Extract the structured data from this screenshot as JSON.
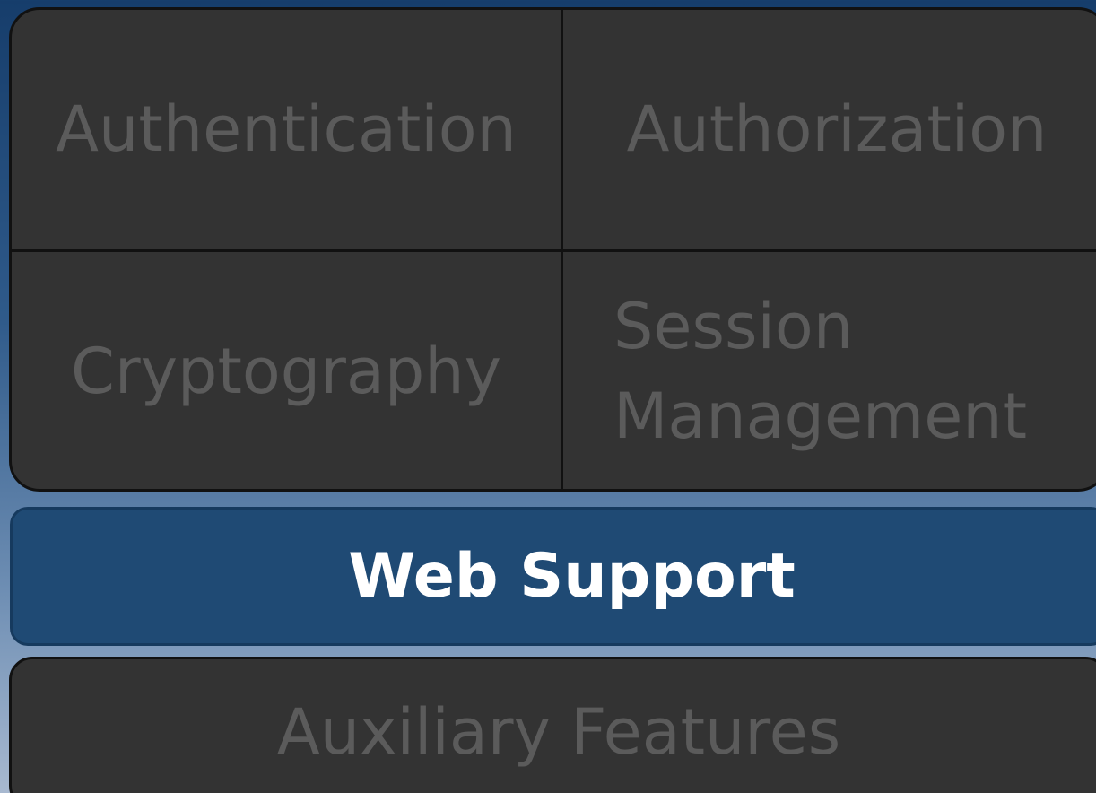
{
  "modules": {
    "authentication": "Authentication",
    "authorization": "Authorization",
    "cryptography": "Cryptography",
    "session_management": "Session\nManagement",
    "web_support": "Web Support",
    "auxiliary_features": "Auxiliary Features"
  },
  "colors": {
    "panel": "#333333",
    "panel_text": "#5b5b5b",
    "highlight": "#1f4a74",
    "highlight_text": "#ffffff",
    "border": "#111111"
  }
}
